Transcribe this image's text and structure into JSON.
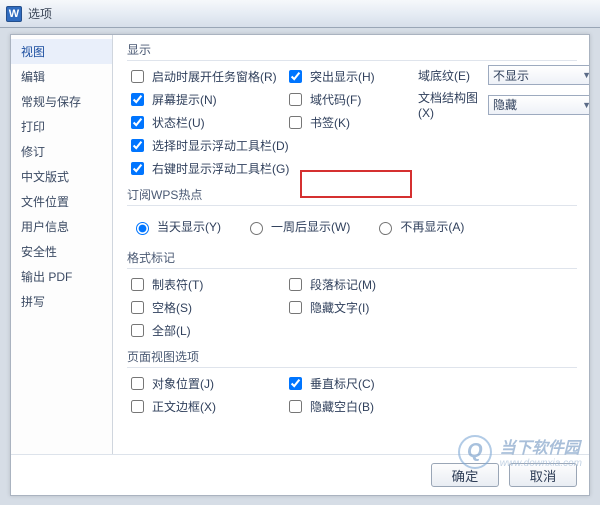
{
  "window": {
    "title": "选项"
  },
  "sidebar": {
    "items": [
      {
        "id": "view",
        "label": "视图",
        "active": true
      },
      {
        "id": "edit",
        "label": "编辑"
      },
      {
        "id": "general",
        "label": "常规与保存"
      },
      {
        "id": "print",
        "label": "打印"
      },
      {
        "id": "revise",
        "label": "修订"
      },
      {
        "id": "chinese",
        "label": "中文版式"
      },
      {
        "id": "fileloc",
        "label": "文件位置"
      },
      {
        "id": "userinfo",
        "label": "用户信息"
      },
      {
        "id": "security",
        "label": "安全性"
      },
      {
        "id": "pdf",
        "label": "输出 PDF"
      },
      {
        "id": "spell",
        "label": "拼写"
      }
    ]
  },
  "groups": {
    "display": {
      "title": "显示",
      "left": [
        {
          "label": "启动时展开任务窗格(R)",
          "checked": false
        },
        {
          "label": "屏幕提示(N)",
          "checked": true
        },
        {
          "label": "状态栏(U)",
          "checked": true
        },
        {
          "label": "选择时显示浮动工具栏(D)",
          "checked": true
        },
        {
          "label": "右键时显示浮动工具栏(G)",
          "checked": true
        }
      ],
      "mid": [
        {
          "label": "突出显示(H)",
          "checked": true
        },
        {
          "label": "域代码(F)",
          "checked": false
        },
        {
          "label": "书签(K)",
          "checked": false
        }
      ],
      "right": [
        {
          "flabel": "域底纹(E)",
          "value": "不显示"
        },
        {
          "flabel": "文档结构图(X)",
          "value": "隐藏"
        }
      ]
    },
    "wpshot": {
      "title": "订阅WPS热点",
      "radios": [
        {
          "label": "当天显示(Y)",
          "checked": true
        },
        {
          "label": "一周后显示(W)",
          "checked": false
        },
        {
          "label": "不再显示(A)",
          "checked": false
        }
      ]
    },
    "fmtmark": {
      "title": "格式标记",
      "left": [
        {
          "label": "制表符(T)",
          "checked": false
        },
        {
          "label": "空格(S)",
          "checked": false
        },
        {
          "label": "全部(L)",
          "checked": false
        }
      ],
      "right": [
        {
          "label": "段落标记(M)",
          "checked": false
        },
        {
          "label": "隐藏文字(I)",
          "checked": false
        }
      ]
    },
    "pageview": {
      "title": "页面视图选项",
      "left": [
        {
          "label": "对象位置(J)",
          "checked": false
        },
        {
          "label": "正文边框(X)",
          "checked": false
        }
      ],
      "right": [
        {
          "label": "垂直标尺(C)",
          "checked": true
        },
        {
          "label": "隐藏空白(B)",
          "checked": false
        }
      ]
    }
  },
  "footer": {
    "ok": "确定",
    "cancel": "取消"
  },
  "watermark": {
    "line1": "当下软件园",
    "line2": "www.downxia.com",
    "icon": "Q"
  }
}
